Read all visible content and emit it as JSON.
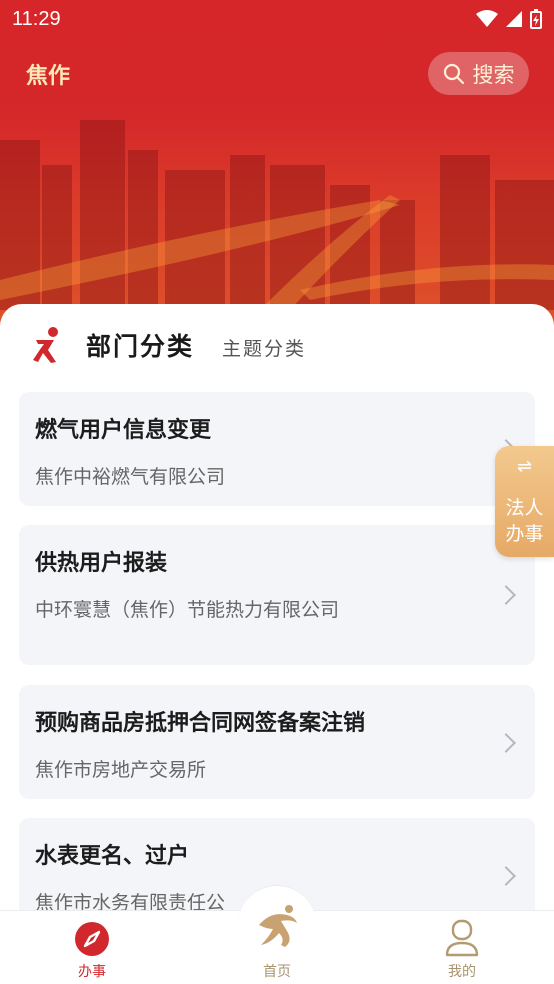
{
  "status_bar": {
    "time": "11:29"
  },
  "header": {
    "city": "焦作",
    "search_label": "搜索"
  },
  "tabs": {
    "department": "部门分类",
    "topic": "主题分类"
  },
  "items": [
    {
      "title": "燃气用户信息变更",
      "org": "焦作中裕燃气有限公司"
    },
    {
      "title": "供热用户报装",
      "org": "中环寰慧（焦作）节能热力有限公司"
    },
    {
      "title": "预购商品房抵押合同网签备案注销",
      "org": "焦作市房地产交易所"
    },
    {
      "title": "水表更名、过户",
      "org": "焦作市水务有限责任公"
    }
  ],
  "side_tab": {
    "line1": "法人",
    "line2": "办事",
    "icon": "swap-icon"
  },
  "bottom_nav": [
    {
      "label": "办事",
      "icon": "compass-icon",
      "active": true
    },
    {
      "label": "首页",
      "icon": "logo-icon",
      "active": false
    },
    {
      "label": "我的",
      "icon": "person-icon",
      "active": false
    }
  ],
  "colors": {
    "brand_red": "#d0282d",
    "gold": "#e6a966",
    "card_bg": "#f4f5f9"
  }
}
